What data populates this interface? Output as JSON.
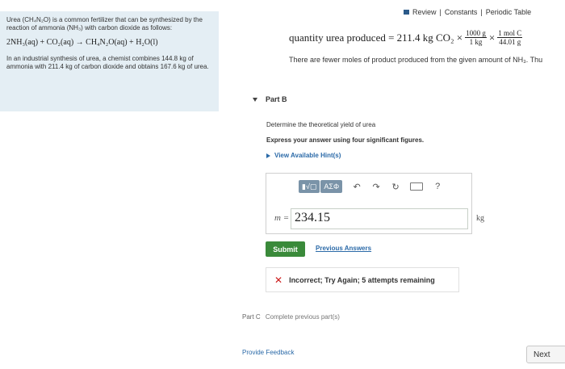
{
  "problem": {
    "intro": "Urea (CH₄N₂O) is a common fertilizer that can be synthesized by the reaction of ammonia (NH₃) with carbon dioxide as follows:",
    "equation": "2NH₃(aq) + CO₂(aq) → CH₄N₂O(aq) + H₂O(l)",
    "synthesis": "In an industrial synthesis of urea, a chemist combines 144.8 kg of ammonia with 211.4 kg of carbon dioxide and obtains 167.6 kg of urea."
  },
  "header": {
    "review": "Review",
    "constants": "Constants",
    "periodic": "Periodic Table",
    "sep": "|"
  },
  "part_a": {
    "calc_prefix": "quantity urea produced = 211.4 kg CO₂ ×",
    "frac1_num": "1000 g",
    "frac1_den": "1 kg",
    "times": "×",
    "frac2_num": "1 mol C",
    "frac2_den": "44.01 g",
    "note": "There are fewer moles of product produced from the given amount of NH₃. Thu"
  },
  "part_b": {
    "title": "Part B",
    "question": "Determine the theoretical yield of urea",
    "instruction": "Express your answer using four significant figures.",
    "hints_label": "View Available Hint(s)",
    "toolbar": {
      "templates": "▮√▢",
      "symbols": "ΑΣΦ",
      "undo": "↶",
      "redo": "↷",
      "reset": "↻",
      "help": "?"
    },
    "var": "m =",
    "answer": "234.15",
    "unit": "kg",
    "submit": "Submit",
    "previous": "Previous Answers",
    "feedback": "Incorrect; Try Again; 5 attempts remaining"
  },
  "part_c": {
    "title": "Part C",
    "text": "Complete previous part(s)"
  },
  "footer": {
    "provide_feedback": "Provide Feedback",
    "next": "Next"
  }
}
